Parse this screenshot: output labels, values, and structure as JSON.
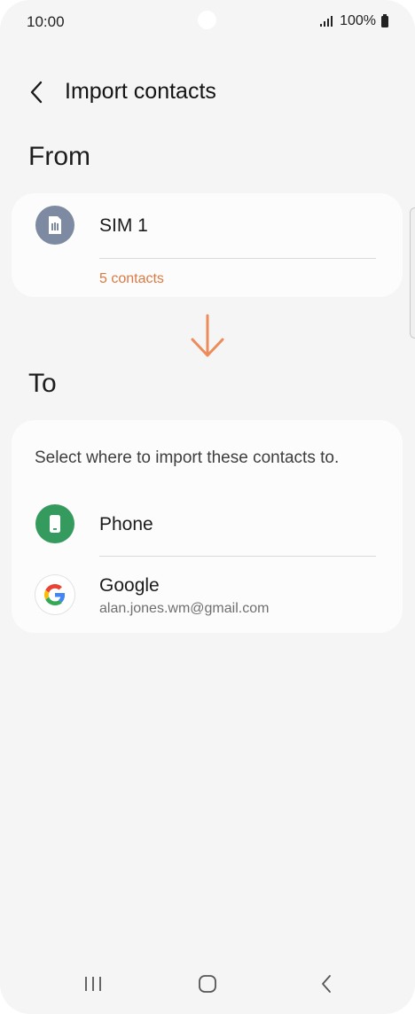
{
  "status_bar": {
    "time": "10:00",
    "battery": "100%"
  },
  "header": {
    "title": "Import contacts"
  },
  "from_section": {
    "label": "From",
    "source": {
      "name": "SIM 1",
      "count": "5 contacts",
      "icon": "sim-card-icon"
    }
  },
  "to_section": {
    "label": "To",
    "description": "Select where to import these contacts to.",
    "options": [
      {
        "name": "Phone",
        "icon": "phone-icon"
      },
      {
        "name": "Google",
        "account": "alan.jones.wm@gmail.com",
        "icon": "google-icon"
      }
    ]
  },
  "colors": {
    "accent": "#d97a43",
    "sim_icon_bg": "#7d8aa1",
    "phone_icon_bg": "#349a5d",
    "background": "#f5f5f5",
    "card": "#fcfcfc"
  }
}
